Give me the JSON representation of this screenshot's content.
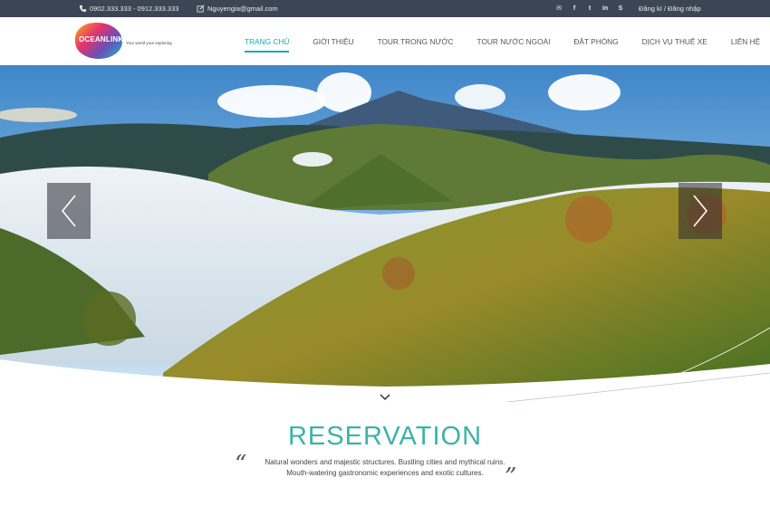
{
  "topbar": {
    "phone": "0902.333.333 - 0912.333.333",
    "email": "Nguyengia@gmail.com",
    "social": [
      {
        "icon": "mail-icon",
        "glyph": "✉"
      },
      {
        "icon": "facebook-icon",
        "glyph": "f"
      },
      {
        "icon": "twitter-icon",
        "glyph": "t"
      },
      {
        "icon": "linkedin-icon",
        "glyph": "in"
      },
      {
        "icon": "skype-icon",
        "glyph": "S"
      }
    ],
    "register": "Đăng kí",
    "separator": "/",
    "login": "Đăng nhập"
  },
  "logo": {
    "brand": "OCEANLINK",
    "tagline": "Your world your exploring"
  },
  "nav": {
    "items": [
      "TRANG CHỦ",
      "GIỚI THIỆU",
      "TOUR TRONG NƯỚC",
      "TOUR NƯỚC NGOÀI",
      "ĐẶT PHÒNG",
      "DỊCH VỤ THUÊ XE",
      "LIÊN HỆ"
    ],
    "active_index": 0
  },
  "reservation": {
    "title": "RESERVATION",
    "line1": "Natural wonders and majestic structures. Bustling cities and mythical ruins.",
    "line2": "Mouth-watering gastronomic experiences and exotic cultures.",
    "quote_open": "“",
    "quote_close": "”"
  },
  "colors": {
    "topbar_bg": "#3c4554",
    "accent": "#19a7b8",
    "title": "#3bb3a8"
  }
}
